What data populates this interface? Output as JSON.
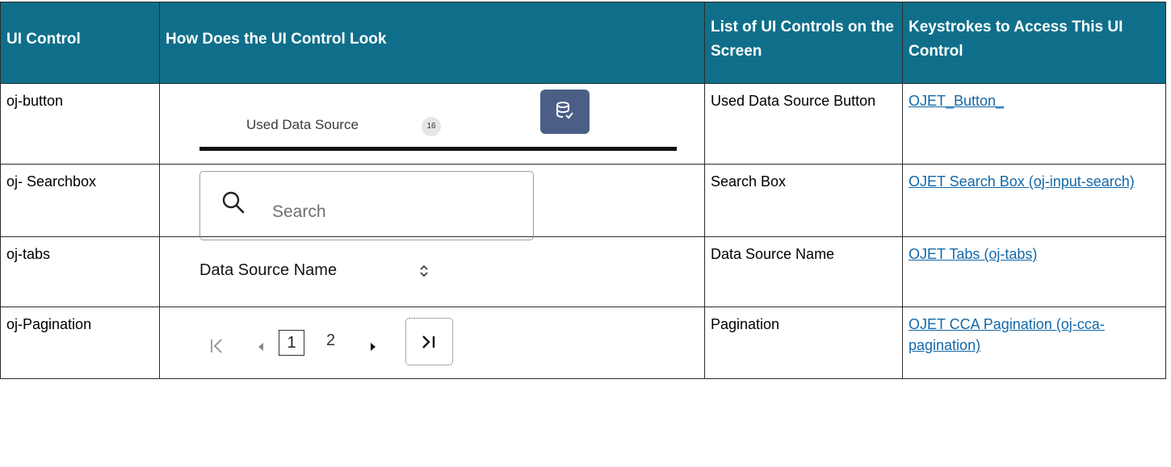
{
  "table": {
    "headers": [
      "UI Control",
      "How Does the UI Control Look",
      "List of UI Controls on the Screen",
      "Keystrokes to Access This UI Control"
    ],
    "rows": [
      {
        "control": "oj-button",
        "list": "Used Data Source Button",
        "link": "OJET_Button_"
      },
      {
        "control": "oj- Searchbox",
        "list": "Search Box",
        "link": "OJET Search Box (oj-input-search)"
      },
      {
        "control": "oj-tabs",
        "list": "Data Source Name",
        "link": "OJET Tabs (oj-tabs)"
      },
      {
        "control": "oj-Pagination",
        "list": "Pagination",
        "link": "OJET CCA Pagination (oj-cca-pagination)"
      }
    ]
  },
  "previews": {
    "button": {
      "tab_label": "Used Data Source",
      "badge": "16",
      "icon": "database-icon"
    },
    "search": {
      "placeholder": "Search",
      "icon": "search-icon"
    },
    "tabs": {
      "label": "Data Source Name",
      "icon": "sort-icon"
    },
    "pagination": {
      "current_page": "1",
      "page2": "2"
    }
  },
  "colors": {
    "header_bg": "#0f6f8a",
    "header_text": "#ffffff",
    "link": "#1368a8",
    "db_button": "#4b5f86"
  }
}
